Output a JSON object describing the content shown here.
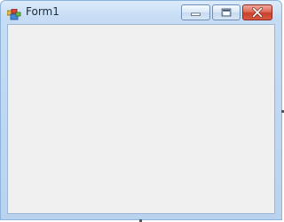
{
  "window": {
    "title": "Form1",
    "icon": "form-app-icon",
    "controls": {
      "minimize": "minimize-icon",
      "maximize": "maximize-icon",
      "close": "close-icon"
    }
  },
  "colors": {
    "frame": "#b9d3ef",
    "client_area": "#f0f0f0",
    "close_button": "#c7412d"
  }
}
